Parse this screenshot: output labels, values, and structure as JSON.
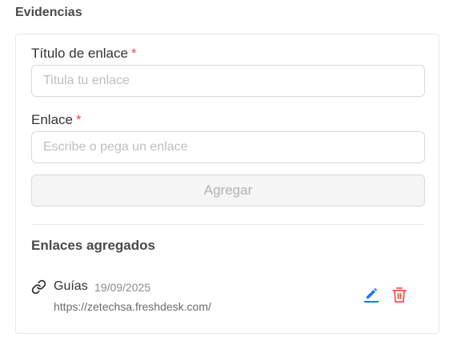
{
  "section": {
    "title": "Evidencias"
  },
  "form": {
    "title_field": {
      "label": "Título de enlace",
      "required_mark": "*",
      "placeholder": "Titula tu enlace",
      "value": ""
    },
    "link_field": {
      "label": "Enlace",
      "required_mark": "*",
      "placeholder": "Escribe o pega un enlace",
      "value": ""
    },
    "add_button_label": "Agregar"
  },
  "links_list": {
    "title": "Enlaces agregados",
    "items": [
      {
        "name": "Guías",
        "date": "19/09/2025",
        "url": "https://zetechsa.freshdesk.com/",
        "icon": "link-icon"
      }
    ]
  },
  "colors": {
    "required": "#e0524f",
    "edit_icon": "#1677ff",
    "delete_icon": "#ff4d4f"
  }
}
